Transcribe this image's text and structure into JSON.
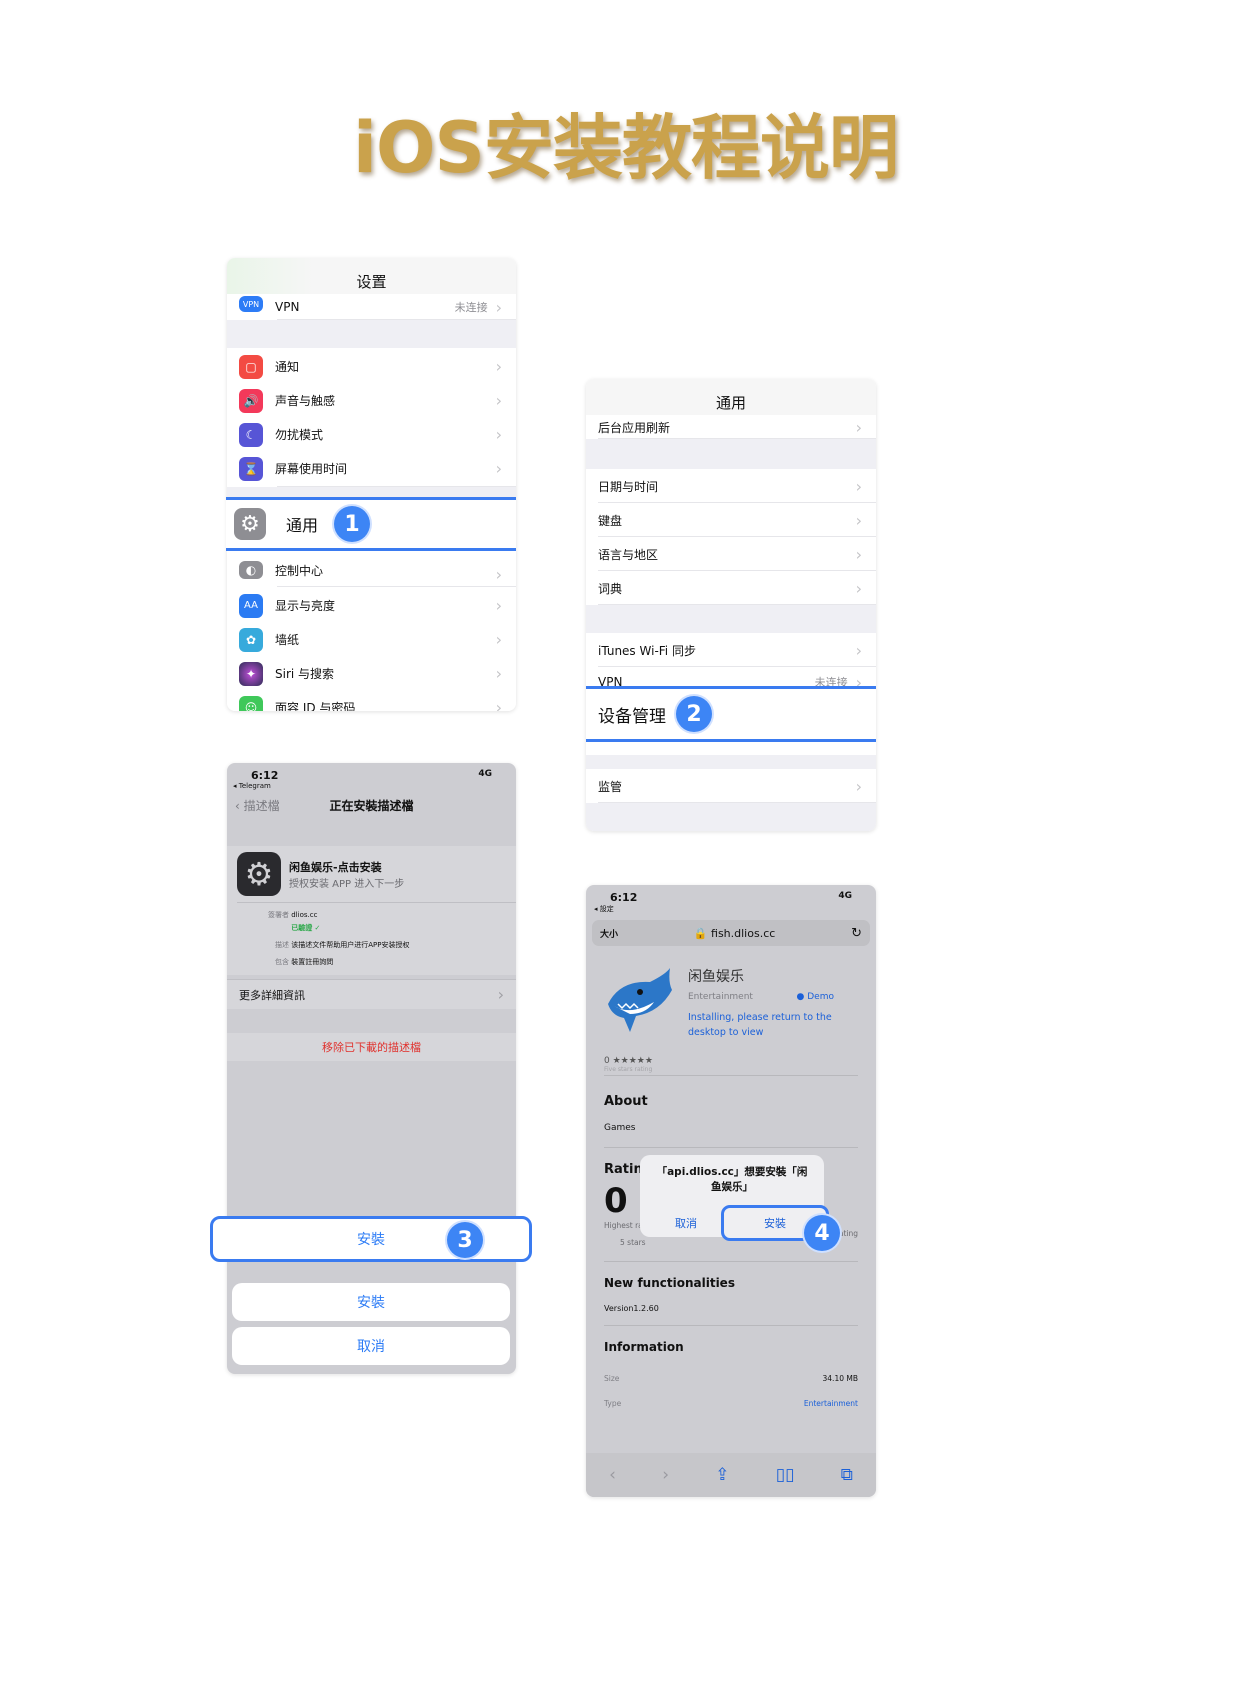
{
  "title": "iOS安装教程说明",
  "step1": {
    "nav_title": "设置",
    "vpn_label": "VPN",
    "vpn_icon_text": "VPN",
    "vpn_value": "未连接",
    "items_top": [
      {
        "label": "通知",
        "icon": "notification-icon",
        "color": "#f34b43"
      },
      {
        "label": "声音与触感",
        "icon": "speaker-icon",
        "color": "#f3395a"
      },
      {
        "label": "勿扰模式",
        "icon": "moon-icon",
        "color": "#5755d6"
      },
      {
        "label": "屏幕使用时间",
        "icon": "hourglass-icon",
        "color": "#5755d6"
      }
    ],
    "highlight_label": "通用",
    "highlight_step": "1",
    "items_bottom": [
      {
        "label": "控制中心",
        "icon": "switches-icon",
        "color": "#8e8e93"
      },
      {
        "label": "显示与亮度",
        "icon": "text-size-icon",
        "color": "#2b7bf3",
        "glyph": "AA"
      },
      {
        "label": "墙纸",
        "icon": "flower-icon",
        "color": "#37aadc"
      },
      {
        "label": "Siri 与搜索",
        "icon": "siri-icon",
        "color": "#2d2d55"
      },
      {
        "label": "面容 ID 与密码",
        "icon": "face-id-icon",
        "color": "#3fc85a"
      }
    ]
  },
  "step2": {
    "nav_title": "通用",
    "top_item": "后台应用刷新",
    "group2": [
      "日期与时间",
      "键盘",
      "语言与地区",
      "词典"
    ],
    "itunes": "iTunes Wi-Fi 同步",
    "vpn_label": "VPN",
    "vpn_value": "未连接",
    "highlight_label": "设备管理",
    "highlight_step": "2",
    "supervise": "监管"
  },
  "step3": {
    "time": "6:12",
    "back_app": "◂ Telegram",
    "network": "4G",
    "nav_back": "描述檔",
    "nav_title": "正在安裝描述檔",
    "profile_name": "闲鱼娱乐-点击安装",
    "profile_sub": "授权安装 APP 进入下一步",
    "signed_label": "簽署者",
    "signed_value": "dlios.cc",
    "verified": "已驗證",
    "desc_label": "描述",
    "desc_value": "该描述文件帮助用户进行APP安装授权",
    "contains_label": "包含",
    "contains_value": "裝置註冊詢問",
    "more_details": "更多詳細資訊",
    "remove": "移除已下載的描述檔",
    "install_highlight": "安裝",
    "highlight_step": "3",
    "install_button": "安裝",
    "cancel_button": "取消"
  },
  "step4": {
    "time": "6:12",
    "back_app": "◂ 設定",
    "network": "4G",
    "text_size": "大小",
    "url": "fish.dlios.cc",
    "app_name": "闲鱼娱乐",
    "category": "Entertainment",
    "demo": "Demo",
    "installing_msg": "Installing, please return to the desktop to view",
    "rating_small": "0 ★★★★★",
    "five_stars_small": "Five stars rating",
    "about": "About",
    "games": "Games",
    "ratings": "Rating",
    "rating_big": "0",
    "highest_rating": "Highest rating:",
    "highest_rating_val": "5 stars",
    "five_stars_rating": "Five stars rating",
    "alert_text": "「api.dlios.cc」想要安裝「闲鱼娱乐」",
    "alert_cancel": "取消",
    "alert_install": "安裝",
    "highlight_step": "4",
    "new_functionalities": "New functionalities",
    "version": "Version1.2.60",
    "information": "Information",
    "size_label": "Size",
    "size_value": "34.10 MB",
    "type_label": "Type",
    "type_value": "Entertainment"
  }
}
